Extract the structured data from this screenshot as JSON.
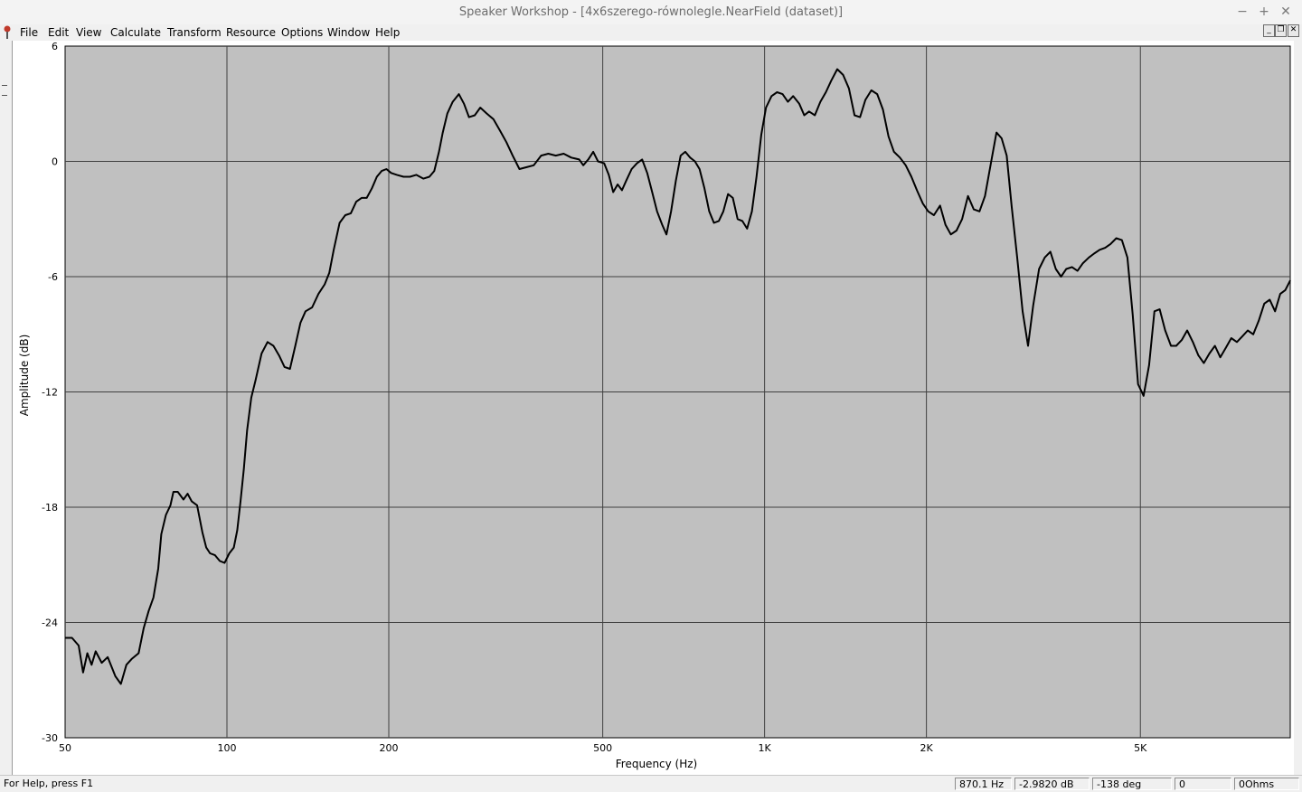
{
  "window": {
    "title": "Speaker Workshop - [4x6szerego-równolegle.NearField (dataset)]",
    "controls": {
      "minimize": "−",
      "maximize": "+",
      "close": "✕"
    }
  },
  "menu": {
    "items": [
      {
        "label": "File"
      },
      {
        "label": "Edit"
      },
      {
        "label": "View"
      },
      {
        "label": "Calculate"
      },
      {
        "label": "Transform"
      },
      {
        "label": "Resource"
      },
      {
        "label": "Options"
      },
      {
        "label": "Window"
      },
      {
        "label": "Help"
      }
    ],
    "mdi_controls": [
      "minimize",
      "restore",
      "close"
    ]
  },
  "chart_data": {
    "type": "line",
    "xlabel": "Frequency (Hz)",
    "ylabel": "Amplitude (dB)",
    "xscale": "log",
    "xlim": [
      50,
      9500
    ],
    "ylim": [
      -30,
      6
    ],
    "grid": true,
    "background_color": "#c0c0c0",
    "line_color": "#000000",
    "x_ticks": [
      50,
      100,
      200,
      500,
      1000,
      2000,
      5000
    ],
    "x_tick_labels": [
      "50",
      "100",
      "200",
      "500",
      "1K",
      "2K",
      "5K"
    ],
    "y_ticks": [
      6,
      0,
      -6,
      -12,
      -18,
      -24,
      -30
    ],
    "y_tick_labels": [
      "6",
      "0",
      "-6",
      "-12",
      "-18",
      "-24",
      "-30"
    ],
    "series": [
      {
        "points": [
          [
            50,
            -24.8
          ],
          [
            51.5,
            -24.8
          ],
          [
            53,
            -25.2
          ],
          [
            54,
            -26.6
          ],
          [
            55,
            -25.6
          ],
          [
            56,
            -26.2
          ],
          [
            57,
            -25.5
          ],
          [
            58.5,
            -26.1
          ],
          [
            60,
            -25.8
          ],
          [
            62,
            -26.8
          ],
          [
            63.5,
            -27.2
          ],
          [
            65,
            -26.2
          ],
          [
            66.5,
            -25.9
          ],
          [
            68.5,
            -25.6
          ],
          [
            70,
            -24.3
          ],
          [
            71.5,
            -23.4
          ],
          [
            73,
            -22.7
          ],
          [
            74.5,
            -21.2
          ],
          [
            75.5,
            -19.4
          ],
          [
            77,
            -18.4
          ],
          [
            78.5,
            -17.9
          ],
          [
            79.5,
            -17.2
          ],
          [
            81,
            -17.2
          ],
          [
            83,
            -17.6
          ],
          [
            84.5,
            -17.3
          ],
          [
            86,
            -17.7
          ],
          [
            88,
            -17.9
          ],
          [
            90,
            -19.3
          ],
          [
            91.5,
            -20.1
          ],
          [
            93,
            -20.4
          ],
          [
            95,
            -20.5
          ],
          [
            97,
            -20.8
          ],
          [
            99,
            -20.9
          ],
          [
            101,
            -20.4
          ],
          [
            103,
            -20.1
          ],
          [
            104.5,
            -19.2
          ],
          [
            106,
            -17.7
          ],
          [
            107.5,
            -16.0
          ],
          [
            109,
            -14.0
          ],
          [
            111,
            -12.3
          ],
          [
            113,
            -11.4
          ],
          [
            116,
            -10.0
          ],
          [
            119,
            -9.4
          ],
          [
            122,
            -9.6
          ],
          [
            125,
            -10.1
          ],
          [
            128,
            -10.7
          ],
          [
            131,
            -10.8
          ],
          [
            134,
            -9.6
          ],
          [
            137,
            -8.4
          ],
          [
            140,
            -7.8
          ],
          [
            144,
            -7.6
          ],
          [
            148,
            -6.9
          ],
          [
            152,
            -6.4
          ],
          [
            155,
            -5.8
          ],
          [
            158,
            -4.6
          ],
          [
            162,
            -3.2
          ],
          [
            166,
            -2.8
          ],
          [
            170,
            -2.7
          ],
          [
            174,
            -2.1
          ],
          [
            178,
            -1.9
          ],
          [
            182,
            -1.9
          ],
          [
            186,
            -1.4
          ],
          [
            190,
            -0.8
          ],
          [
            194,
            -0.5
          ],
          [
            198,
            -0.4
          ],
          [
            202,
            -0.6
          ],
          [
            207,
            -0.7
          ],
          [
            213,
            -0.8
          ],
          [
            219,
            -0.8
          ],
          [
            225,
            -0.7
          ],
          [
            232,
            -0.9
          ],
          [
            238,
            -0.8
          ],
          [
            243,
            -0.5
          ],
          [
            248,
            0.5
          ],
          [
            252,
            1.5
          ],
          [
            257,
            2.5
          ],
          [
            263,
            3.1
          ],
          [
            270,
            3.5
          ],
          [
            276,
            3.0
          ],
          [
            282,
            2.3
          ],
          [
            289,
            2.4
          ],
          [
            296,
            2.8
          ],
          [
            304,
            2.5
          ],
          [
            313,
            2.2
          ],
          [
            322,
            1.6
          ],
          [
            331,
            1.0
          ],
          [
            340,
            0.3
          ],
          [
            350,
            -0.4
          ],
          [
            361,
            -0.3
          ],
          [
            372,
            -0.2
          ],
          [
            384,
            0.3
          ],
          [
            396,
            0.4
          ],
          [
            409,
            0.3
          ],
          [
            423,
            0.4
          ],
          [
            437,
            0.2
          ],
          [
            452,
            0.1
          ],
          [
            460,
            -0.2
          ],
          [
            470,
            0.1
          ],
          [
            480,
            0.5
          ],
          [
            490,
            0.0
          ],
          [
            503,
            -0.1
          ],
          [
            513,
            -0.7
          ],
          [
            523,
            -1.6
          ],
          [
            533,
            -1.2
          ],
          [
            543,
            -1.5
          ],
          [
            553,
            -1.0
          ],
          [
            566,
            -0.4
          ],
          [
            579,
            -0.1
          ],
          [
            592,
            0.1
          ],
          [
            605,
            -0.6
          ],
          [
            618,
            -1.6
          ],
          [
            631,
            -2.6
          ],
          [
            645,
            -3.3
          ],
          [
            657,
            -3.8
          ],
          [
            670,
            -2.6
          ],
          [
            684,
            -1.0
          ],
          [
            698,
            0.3
          ],
          [
            712,
            0.5
          ],
          [
            727,
            0.2
          ],
          [
            742,
            0.0
          ],
          [
            757,
            -0.4
          ],
          [
            773,
            -1.4
          ],
          [
            789,
            -2.6
          ],
          [
            805,
            -3.2
          ],
          [
            822,
            -3.1
          ],
          [
            838,
            -2.6
          ],
          [
            855,
            -1.7
          ],
          [
            873,
            -1.9
          ],
          [
            891,
            -3.0
          ],
          [
            909,
            -3.1
          ],
          [
            928,
            -3.5
          ],
          [
            947,
            -2.6
          ],
          [
            966,
            -0.8
          ],
          [
            986,
            1.4
          ],
          [
            1006,
            2.8
          ],
          [
            1030,
            3.4
          ],
          [
            1055,
            3.6
          ],
          [
            1080,
            3.5
          ],
          [
            1105,
            3.1
          ],
          [
            1130,
            3.4
          ],
          [
            1160,
            3.0
          ],
          [
            1185,
            2.4
          ],
          [
            1210,
            2.6
          ],
          [
            1240,
            2.4
          ],
          [
            1270,
            3.1
          ],
          [
            1300,
            3.6
          ],
          [
            1330,
            4.2
          ],
          [
            1365,
            4.8
          ],
          [
            1400,
            4.5
          ],
          [
            1435,
            3.8
          ],
          [
            1470,
            2.4
          ],
          [
            1505,
            2.3
          ],
          [
            1540,
            3.2
          ],
          [
            1580,
            3.7
          ],
          [
            1620,
            3.5
          ],
          [
            1660,
            2.7
          ],
          [
            1700,
            1.3
          ],
          [
            1740,
            0.5
          ],
          [
            1785,
            0.2
          ],
          [
            1830,
            -0.2
          ],
          [
            1875,
            -0.8
          ],
          [
            1920,
            -1.5
          ],
          [
            1970,
            -2.2
          ],
          [
            2015,
            -2.6
          ],
          [
            2065,
            -2.8
          ],
          [
            2120,
            -2.3
          ],
          [
            2170,
            -3.3
          ],
          [
            2220,
            -3.8
          ],
          [
            2275,
            -3.6
          ],
          [
            2330,
            -3.0
          ],
          [
            2390,
            -1.8
          ],
          [
            2450,
            -2.5
          ],
          [
            2510,
            -2.6
          ],
          [
            2570,
            -1.8
          ],
          [
            2640,
            0.0
          ],
          [
            2700,
            1.5
          ],
          [
            2760,
            1.2
          ],
          [
            2820,
            0.3
          ],
          [
            2880,
            -2.3
          ],
          [
            2950,
            -5.0
          ],
          [
            3020,
            -7.8
          ],
          [
            3090,
            -9.6
          ],
          [
            3160,
            -7.5
          ],
          [
            3240,
            -5.6
          ],
          [
            3320,
            -5.0
          ],
          [
            3400,
            -4.7
          ],
          [
            3480,
            -5.6
          ],
          [
            3560,
            -6.0
          ],
          [
            3640,
            -5.6
          ],
          [
            3730,
            -5.5
          ],
          [
            3820,
            -5.7
          ],
          [
            3910,
            -5.3
          ],
          [
            4010,
            -5.0
          ],
          [
            4100,
            -4.8
          ],
          [
            4200,
            -4.6
          ],
          [
            4300,
            -4.5
          ],
          [
            4400,
            -4.3
          ],
          [
            4510,
            -4.0
          ],
          [
            4620,
            -4.1
          ],
          [
            4730,
            -5.0
          ],
          [
            4840,
            -8.0
          ],
          [
            4950,
            -11.6
          ],
          [
            5070,
            -12.2
          ],
          [
            5190,
            -10.6
          ],
          [
            5310,
            -7.8
          ],
          [
            5430,
            -7.7
          ],
          [
            5560,
            -8.8
          ],
          [
            5700,
            -9.6
          ],
          [
            5830,
            -9.6
          ],
          [
            5970,
            -9.3
          ],
          [
            6110,
            -8.8
          ],
          [
            6260,
            -9.4
          ],
          [
            6410,
            -10.1
          ],
          [
            6560,
            -10.5
          ],
          [
            6720,
            -10.0
          ],
          [
            6880,
            -9.6
          ],
          [
            7040,
            -10.2
          ],
          [
            7210,
            -9.7
          ],
          [
            7380,
            -9.2
          ],
          [
            7560,
            -9.4
          ],
          [
            7740,
            -9.1
          ],
          [
            7920,
            -8.8
          ],
          [
            8110,
            -9.0
          ],
          [
            8300,
            -8.3
          ],
          [
            8500,
            -7.4
          ],
          [
            8700,
            -7.2
          ],
          [
            8900,
            -7.8
          ],
          [
            9100,
            -6.9
          ],
          [
            9300,
            -6.7
          ],
          [
            9500,
            -6.2
          ]
        ]
      }
    ]
  },
  "status": {
    "help": "For Help, press F1",
    "frequency": "870.1 Hz",
    "amplitude": "-2.9820 dB",
    "phase": "-138 deg",
    "value": "0",
    "impedance": "0Ohms"
  }
}
